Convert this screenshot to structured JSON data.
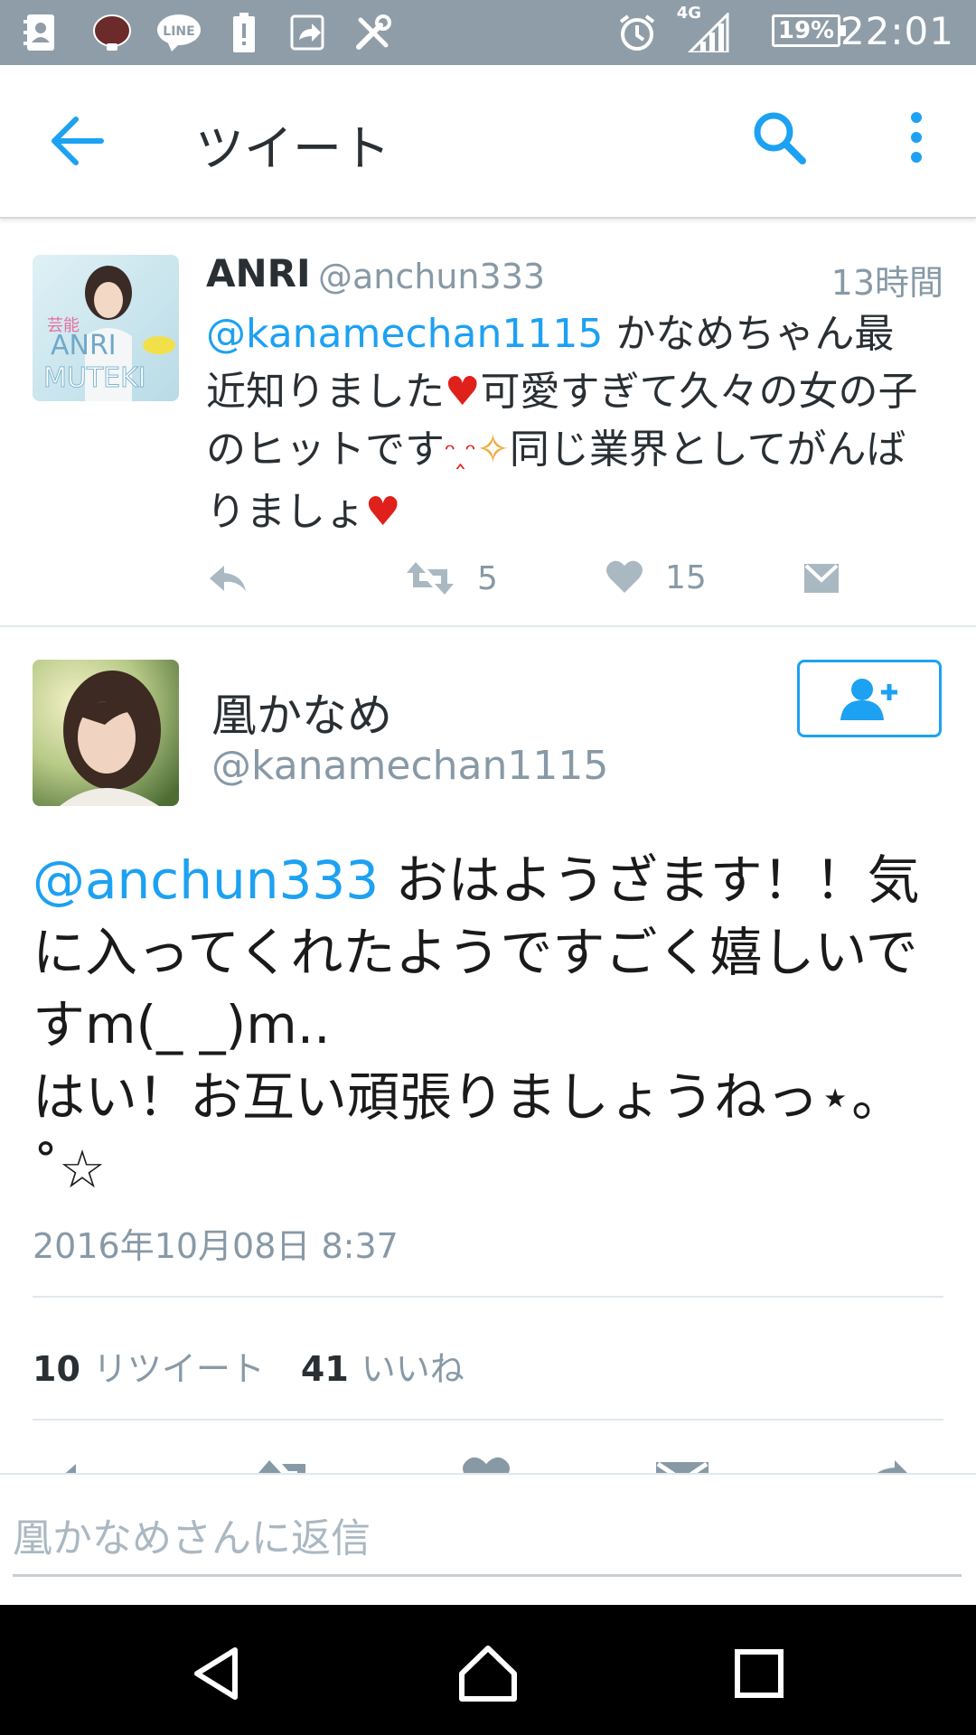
{
  "status_bar": {
    "time": "22:01",
    "battery": "19%",
    "network": "4G",
    "icons": [
      "contacts-icon",
      "app-icon",
      "line-icon",
      "battery-alert-icon",
      "share-icon",
      "tools-icon",
      "alarm-icon",
      "signal-icon"
    ]
  },
  "toolbar": {
    "title": "ツイート"
  },
  "tweet1": {
    "name": "ANRI",
    "handle": "@anchun333",
    "time": "13時間",
    "mention": "@kanamechan1115",
    "text_a": " かなめちゃん最近知りました",
    "heart_a": "♥",
    "text_b": "可愛すぎて久々の女の子のヒットです",
    "emoji_a": "ᵔ‸ᵔ",
    "sparkle": "✧",
    "text_c": "同じ業界としてがんばりましょ",
    "heart_b": "♥",
    "retweet_count": "5",
    "like_count": "15",
    "avatar_text": [
      "芸能",
      "ANRI",
      "MUTEKI"
    ]
  },
  "tweet2": {
    "name": "凰かなめ",
    "handle": "@kanamechan1115",
    "mention": "@anchun333",
    "text": " おはようざます！！気に入ってくれたようですごく嬉しいですm(_ _)m..\nはい！お互い頑張りましょうねっ⋆。 ˚☆",
    "date": "2016年10月08日 8:37",
    "retweets_num": "10",
    "retweets_label": "リツイート",
    "likes_num": "41",
    "likes_label": "いいね"
  },
  "reply": {
    "placeholder": "凰かなめさんに返信"
  },
  "colors": {
    "accent": "#1da1f2",
    "status_bar": "#8f9da8",
    "muted": "#8899a6",
    "heart": "#e0201a"
  }
}
